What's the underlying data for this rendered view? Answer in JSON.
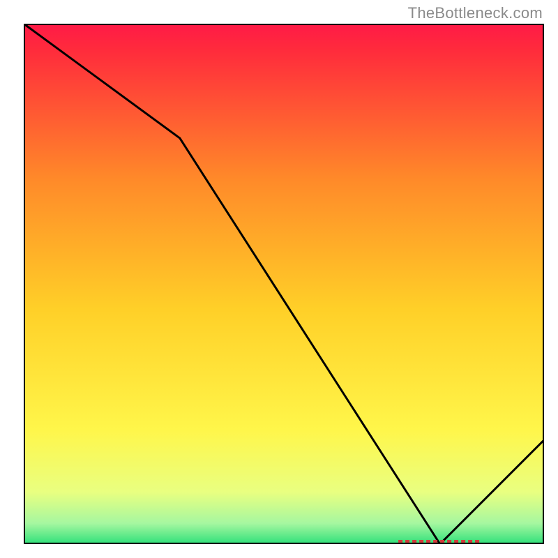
{
  "watermark": "TheBottleneck.com",
  "chart_data": {
    "type": "line",
    "title": "",
    "xlabel": "",
    "ylabel": "",
    "xlim": [
      0,
      100
    ],
    "ylim": [
      0,
      100
    ],
    "series": [
      {
        "name": "line",
        "x": [
          0,
          30,
          80,
          100
        ],
        "y": [
          100,
          78,
          0,
          20
        ]
      }
    ],
    "optimum_band": {
      "x_start": 72,
      "x_end": 88,
      "y": 0
    },
    "gradient": {
      "stops": [
        {
          "offset": 0.0,
          "color": "#ff1a47"
        },
        {
          "offset": 0.05,
          "color": "#ff2b3c"
        },
        {
          "offset": 0.3,
          "color": "#ff8a29"
        },
        {
          "offset": 0.55,
          "color": "#ffd028"
        },
        {
          "offset": 0.78,
          "color": "#fff64a"
        },
        {
          "offset": 0.9,
          "color": "#e9ff80"
        },
        {
          "offset": 0.96,
          "color": "#a6f7a0"
        },
        {
          "offset": 1.0,
          "color": "#2fe07a"
        }
      ]
    }
  }
}
